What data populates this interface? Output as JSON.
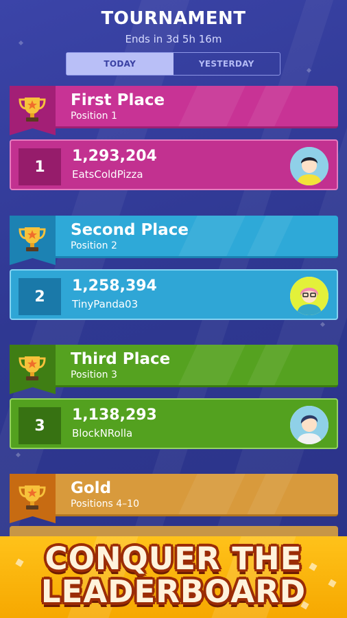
{
  "header": {
    "title": "TOURNAMENT",
    "subtitle": "Ends in 3d 5h 16m",
    "tabs": [
      {
        "label": "TODAY",
        "active": true
      },
      {
        "label": "YESTERDAY",
        "active": false
      }
    ]
  },
  "tiers": [
    {
      "title": "First Place",
      "subtitle": "Position 1",
      "color": "#c83395"
    },
    {
      "title": "Second Place",
      "subtitle": "Position 2",
      "color": "#2ea9d8"
    },
    {
      "title": "Third Place",
      "subtitle": "Position 3",
      "color": "#55a220"
    },
    {
      "title": "Gold",
      "subtitle": "Positions 4–10",
      "color": "#d89a3c"
    }
  ],
  "players": [
    {
      "rank": "1",
      "score": "1,293,204",
      "name": "EatsColdPizza",
      "avatar": "boy-avatar-icon"
    },
    {
      "rank": "2",
      "score": "1,258,394",
      "name": "TinyPanda03",
      "avatar": "girl-glasses-avatar-icon"
    },
    {
      "rank": "3",
      "score": "1,138,293",
      "name": "BlockNRolla",
      "avatar": "boy-avatar-icon"
    }
  ],
  "banner": {
    "line1": "CONQUER THE",
    "line2": "LEADERBOARD"
  },
  "icons": {
    "trophy": "trophy-icon"
  }
}
